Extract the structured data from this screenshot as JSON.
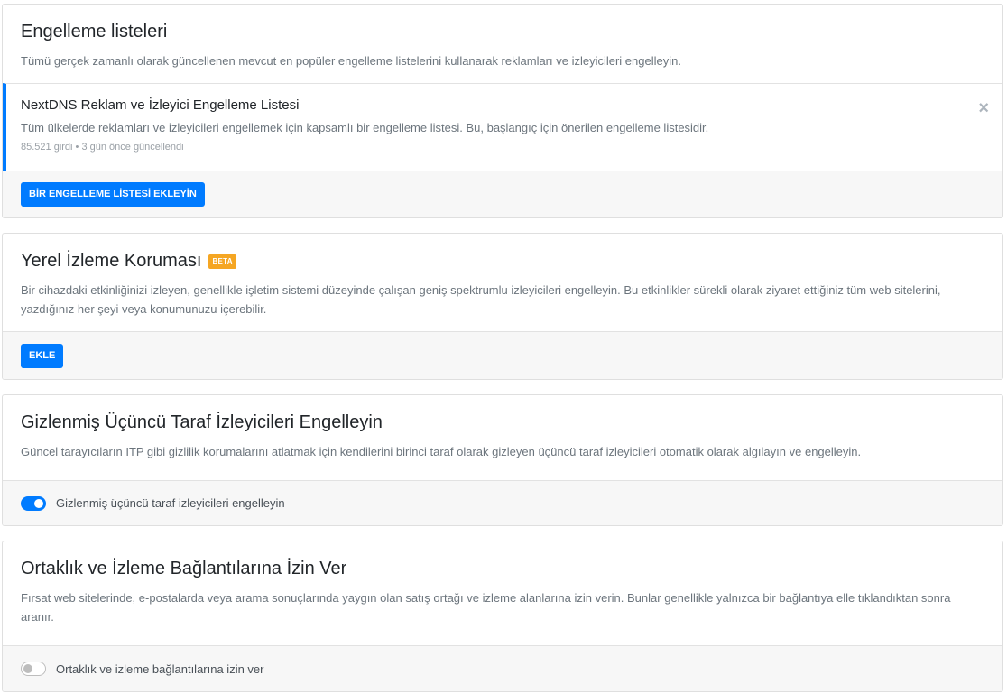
{
  "blocklists": {
    "title": "Engelleme listeleri",
    "description": "Tümü gerçek zamanlı olarak güncellenen mevcut en popüler engelleme listelerini kullanarak reklamları ve izleyicileri engelleyin.",
    "items": [
      {
        "name": "NextDNS Reklam ve İzleyici Engelleme Listesi",
        "description": "Tüm ülkelerde reklamları ve izleyicileri engellemek için kapsamlı bir engelleme listesi. Bu, başlangıç için önerilen engelleme listesidir.",
        "meta": "85.521 girdi • 3 gün önce güncellendi"
      }
    ],
    "close_icon": "×",
    "add_button": "BİR ENGELLEME LİSTESİ EKLEYİN"
  },
  "native_tracking": {
    "title": "Yerel İzleme Koruması",
    "badge": "BETA",
    "description": "Bir cihazdaki etkinliğinizi izleyen, genellikle işletim sistemi düzeyinde çalışan geniş spektrumlu izleyicileri engelleyin. Bu etkinlikler sürekli olarak ziyaret ettiğiniz tüm web sitelerini, yazdığınız her şeyi veya konumunuzu içerebilir.",
    "add_button": "EKLE"
  },
  "disguised_trackers": {
    "title": "Gizlenmiş Üçüncü Taraf İzleyicileri Engelleyin",
    "description": "Güncel tarayıcıların ITP gibi gizlilik korumalarını atlatmak için kendilerini birinci taraf olarak gizleyen üçüncü taraf izleyicileri otomatik olarak algılayın ve engelleyin.",
    "toggle_label": "Gizlenmiş üçüncü taraf izleyicileri engelleyin",
    "toggle_on": true
  },
  "affiliate_links": {
    "title": "Ortaklık ve İzleme Bağlantılarına İzin Ver",
    "description": "Fırsat web sitelerinde, e-postalarda veya arama sonuçlarında yaygın olan satış ortağı ve izleme alanlarına izin verin. Bunlar genellikle yalnızca bir bağlantıya elle tıklandıktan sonra aranır.",
    "toggle_label": "Ortaklık ve izleme bağlantılarına izin ver",
    "toggle_on": false
  },
  "colors": {
    "accent": "#007bff",
    "beta": "#f5a623",
    "muted": "#6c757d"
  },
  "icons": {
    "close": "close-icon"
  }
}
